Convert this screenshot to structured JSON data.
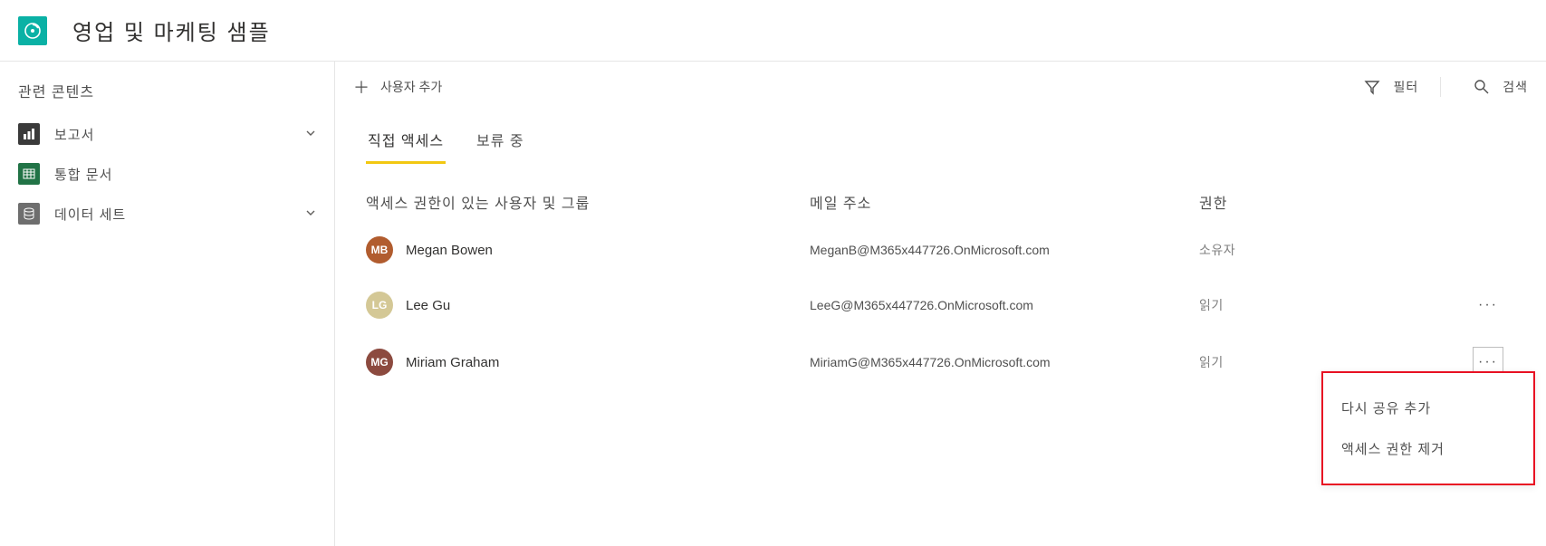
{
  "header": {
    "title": "영업 및 마케팅 샘플"
  },
  "sidebar": {
    "title": "관련 콘텐츠",
    "items": [
      {
        "label": "보고서",
        "expandable": true
      },
      {
        "label": "통합 문서",
        "expandable": false
      },
      {
        "label": "데이터 세트",
        "expandable": true
      }
    ]
  },
  "toolbar": {
    "add_user_label": "사용자 추가",
    "filter_label": "필터",
    "search_label": "검색"
  },
  "tabs": [
    {
      "label": "직접 액세스",
      "active": true
    },
    {
      "label": "보류 중",
      "active": false
    }
  ],
  "table": {
    "headers": {
      "user": "액세스 권한이 있는 사용자 및 그룹",
      "email": "메일 주소",
      "permission": "권한"
    },
    "rows": [
      {
        "name": "Megan Bowen",
        "email": "MeganB@M365x447726.OnMicrosoft.com",
        "permission": "소유자",
        "avatar_bg": "#b15c2e",
        "initials": "MB",
        "show_more": false
      },
      {
        "name": "Lee Gu",
        "email": "LeeG@M365x447726.OnMicrosoft.com",
        "permission": "읽기",
        "avatar_bg": "#d4c896",
        "initials": "LG",
        "show_more": true,
        "more_outlined": false
      },
      {
        "name": "Miriam Graham",
        "email": "MiriamG@M365x447726.OnMicrosoft.com",
        "permission": "읽기",
        "avatar_bg": "#8c4a3f",
        "initials": "MG",
        "show_more": true,
        "more_outlined": true
      }
    ]
  },
  "context_menu": {
    "items": [
      {
        "label": "다시 공유 추가"
      },
      {
        "label": "액세스 권한 제거"
      }
    ]
  }
}
